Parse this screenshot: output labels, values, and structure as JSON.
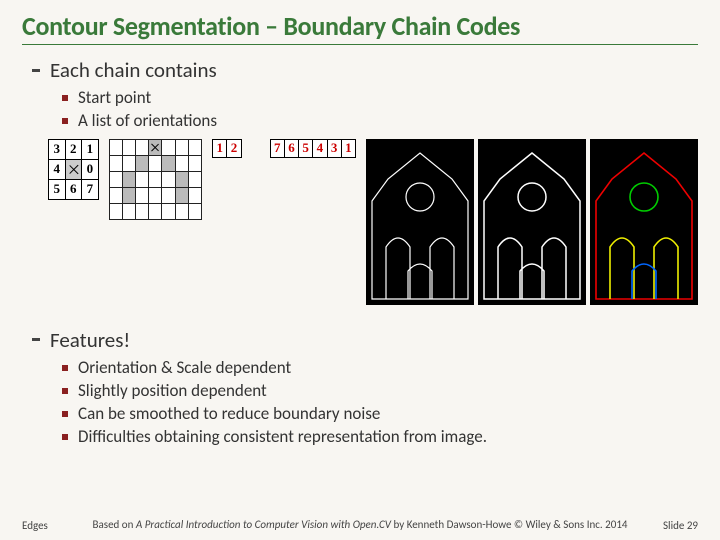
{
  "title": "Contour Segmentation – Boundary Chain Codes",
  "section1": {
    "heading": "Each chain contains",
    "items": [
      "Start point",
      "A list of orientations"
    ]
  },
  "diagrams": {
    "direction_grid": [
      [
        "3",
        "2",
        "1"
      ],
      [
        "4",
        "X",
        "0"
      ],
      [
        "5",
        "6",
        "7"
      ]
    ],
    "chain_strip_a": [
      "1",
      "2"
    ],
    "chain_strip_b": [
      "7",
      "6",
      "5",
      "4",
      "3",
      "1"
    ]
  },
  "section2": {
    "heading": "Features!",
    "items": [
      "Orientation & Scale dependent",
      "Slightly position dependent",
      "Can be smoothed to reduce boundary noise",
      "Difficulties obtaining consistent representation from image."
    ]
  },
  "footer": {
    "left": "Edges",
    "mid_prefix": "Based on ",
    "mid_title": "A Practical Introduction to Computer Vision with Open.CV",
    "mid_suffix": " by Kenneth Dawson-Howe © Wiley & Sons Inc. 2014",
    "right": "Slide 29"
  }
}
